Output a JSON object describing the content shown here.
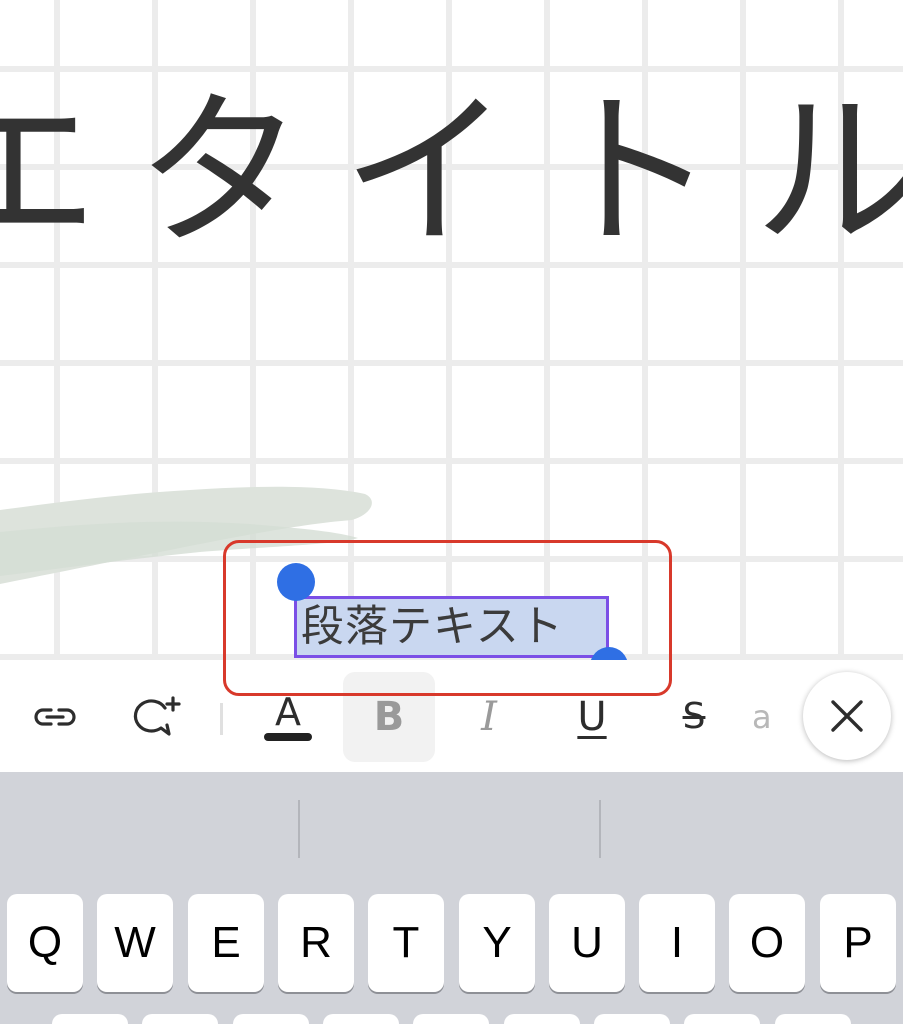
{
  "canvas": {
    "title_text": "エタイトル",
    "paragraph_text": "段落テキスト"
  },
  "toolbar": {
    "text_color_letter": "A",
    "bold_label": "B",
    "italic_label": "I",
    "underline_label": "U",
    "strike_label": "S",
    "more_label": "a"
  },
  "keyboard": {
    "top_row": [
      "Q",
      "W",
      "E",
      "R",
      "T",
      "Y",
      "U",
      "I",
      "O",
      "P"
    ]
  },
  "colors": {
    "selection_frame": "#d8392b",
    "text_selection_bg": "#c9d7f0",
    "text_selection_border": "#7b4fe6",
    "selection_handle": "#2f6fe4",
    "keyboard_bg": "#d1d3d9"
  }
}
